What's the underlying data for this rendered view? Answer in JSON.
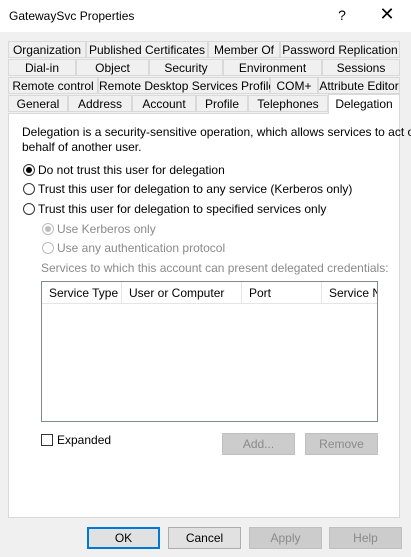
{
  "window": {
    "title": "GatewaySvc Properties",
    "help": "?",
    "close": "✕"
  },
  "tabs": {
    "row1": [
      "Organization",
      "Published Certificates",
      "Member Of",
      "Password Replication"
    ],
    "row2": [
      "Dial-in",
      "Object",
      "Security",
      "Environment",
      "Sessions"
    ],
    "row3": [
      "Remote control",
      "Remote Desktop Services Profile",
      "COM+",
      "Attribute Editor"
    ],
    "row4": [
      "General",
      "Address",
      "Account",
      "Profile",
      "Telephones",
      "Delegation"
    ],
    "active": "Delegation"
  },
  "delegation": {
    "description_line1": "Delegation is a security-sensitive operation, which allows services to act on",
    "description_line2": "behalf of another user.",
    "options": [
      {
        "label": "Do not trust this user for delegation",
        "checked": true
      },
      {
        "label": "Trust this user for delegation to any service (Kerberos only)",
        "checked": false
      },
      {
        "label": "Trust this user for delegation to specified services only",
        "checked": false
      }
    ],
    "sub_options": [
      {
        "label": "Use Kerberos only",
        "checked": true
      },
      {
        "label": "Use any authentication protocol",
        "checked": false
      }
    ],
    "services_label": "Services to which this account can present delegated credentials:",
    "columns": [
      "Service Type",
      "User or Computer",
      "Port",
      "Service Name"
    ],
    "expanded_label": "Expanded",
    "add_label": "Add...",
    "remove_label": "Remove"
  },
  "footer": {
    "ok": "OK",
    "cancel": "Cancel",
    "apply": "Apply",
    "help": "Help"
  }
}
